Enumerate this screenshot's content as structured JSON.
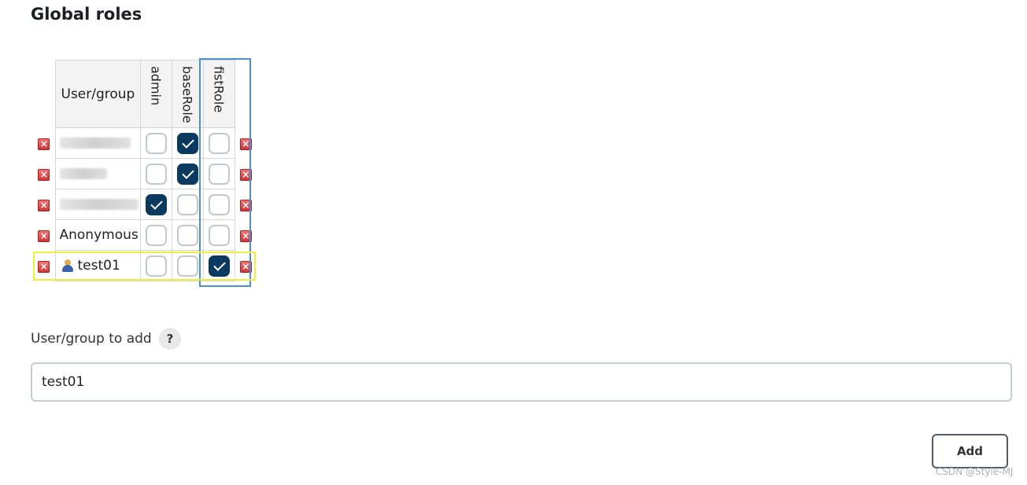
{
  "section": {
    "title": "Global roles"
  },
  "table": {
    "user_header": "User/group",
    "roles": [
      "admin",
      "baseRole",
      "fistRole"
    ],
    "rows": [
      {
        "name": "",
        "obscured": true,
        "blur_width": 90,
        "icon": null,
        "checks": [
          false,
          true,
          false
        ]
      },
      {
        "name": "",
        "obscured": true,
        "blur_width": 60,
        "icon": null,
        "checks": [
          false,
          true,
          false
        ]
      },
      {
        "name": "",
        "obscured": true,
        "blur_width": 100,
        "icon": null,
        "checks": [
          true,
          false,
          false
        ]
      },
      {
        "name": "Anonymous",
        "obscured": false,
        "icon": null,
        "checks": [
          false,
          false,
          false
        ]
      },
      {
        "name": "test01",
        "obscured": false,
        "icon": "user-icon",
        "checks": [
          false,
          false,
          true
        ]
      }
    ],
    "delete_icon": "close-icon"
  },
  "add_form": {
    "label": "User/group to add",
    "help_label": "?",
    "input_value": "test01",
    "button_label": "Add"
  },
  "watermark": "CSDN @Style-MJ",
  "colors": {
    "checkbox_checked": "#0a3a5f",
    "highlight_column": "#4a90d9",
    "highlight_row": "#f0f03a",
    "delete_icon": "#c83232"
  }
}
